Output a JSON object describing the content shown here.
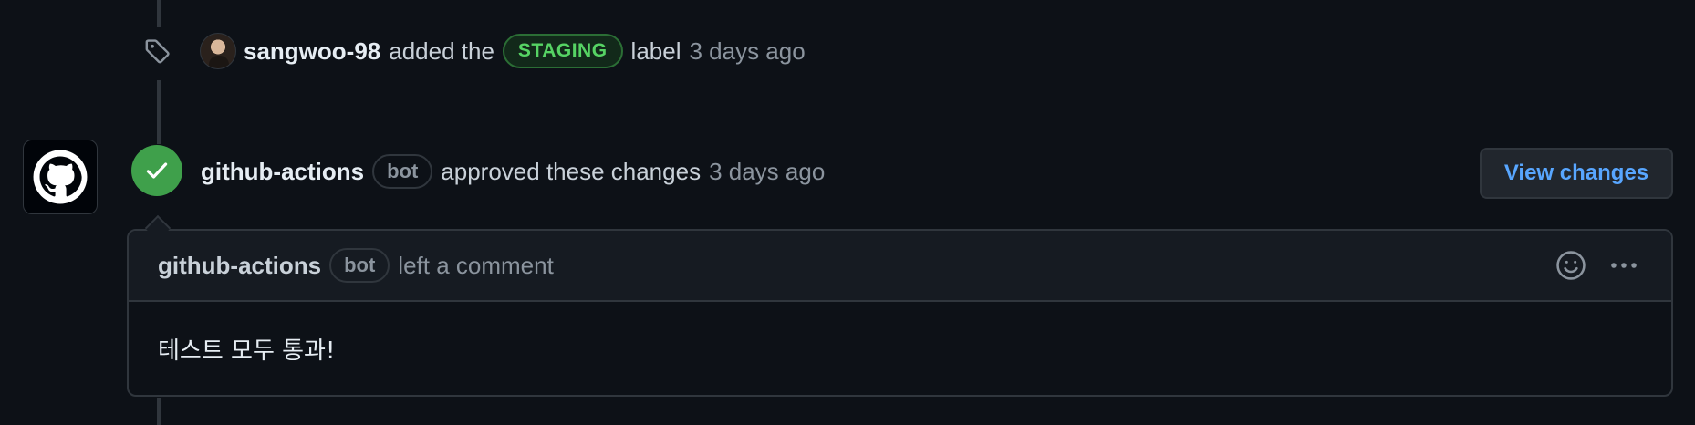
{
  "label_event": {
    "author": "sangwoo-98",
    "action_prefix": "added the",
    "label_name": "STAGING",
    "action_suffix": "label",
    "time": "3 days ago",
    "icons": {
      "event": "tag-icon",
      "avatar": "user-avatar"
    }
  },
  "review": {
    "author": "github-actions",
    "bot_badge": "bot",
    "action": "approved these changes",
    "time": "3 days ago",
    "view_changes_label": "View changes",
    "icons": {
      "avatar": "github-mark-icon",
      "status": "check-icon"
    },
    "status_color": "#3fa04b"
  },
  "comment": {
    "author": "github-actions",
    "bot_badge": "bot",
    "action": "left a comment",
    "body": "테스트 모두 통과!",
    "icons": {
      "reaction": "smiley-icon",
      "menu": "kebab-horizontal-icon"
    }
  },
  "colors": {
    "background": "#0d1117",
    "accent_link": "#58a6ff",
    "label_green": "#56d364",
    "border": "#30363d"
  }
}
